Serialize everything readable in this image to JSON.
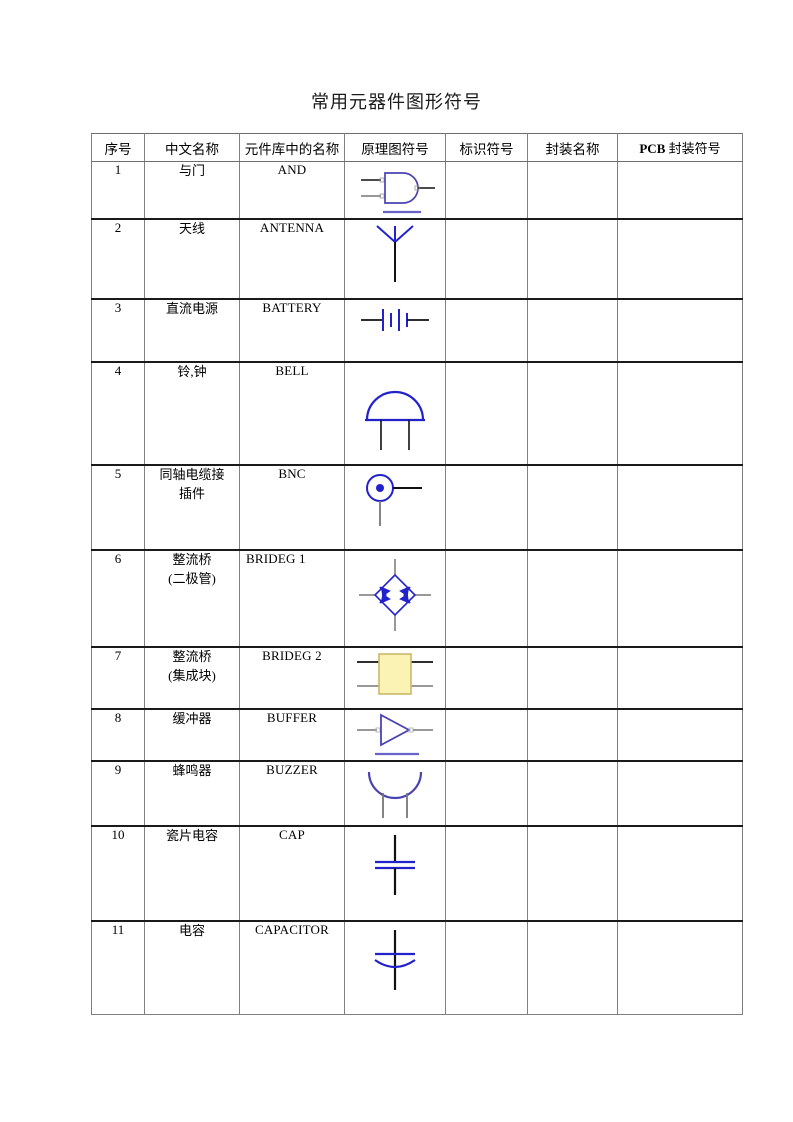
{
  "document": {
    "title": "常用元器件图形符号"
  },
  "table": {
    "headers": [
      "序号",
      "中文名称",
      "元件库中的名称",
      "原理图符号",
      "标识符号",
      "封装名称",
      "PCB 封装符号"
    ],
    "header_pcb_bold_prefix": "PCB",
    "header_pcb_rest": " 封装符号",
    "rows": [
      {
        "index": "1",
        "chinese_name": "与门",
        "library_name": "AND",
        "symbol": "and-gate",
        "designator": "",
        "package_name": "",
        "pcb_symbol": ""
      },
      {
        "index": "2",
        "chinese_name": "天线",
        "library_name": "ANTENNA",
        "symbol": "antenna",
        "designator": "",
        "package_name": "",
        "pcb_symbol": ""
      },
      {
        "index": "3",
        "chinese_name": "直流电源",
        "library_name": "BATTERY",
        "symbol": "battery",
        "designator": "",
        "package_name": "",
        "pcb_symbol": ""
      },
      {
        "index": "4",
        "chinese_name": "铃,钟",
        "library_name": "BELL",
        "symbol": "bell",
        "designator": "",
        "package_name": "",
        "pcb_symbol": ""
      },
      {
        "index": "5",
        "chinese_name": "同轴电缆接插件",
        "library_name": "BNC",
        "symbol": "bnc-connector",
        "designator": "",
        "package_name": "",
        "pcb_symbol": ""
      },
      {
        "index": "6",
        "chinese_name_line1": "整流桥",
        "chinese_name_line2": "(二极管)",
        "library_name": "BRIDEG 1",
        "symbol": "bridge-rectifier-diodes",
        "designator": "",
        "package_name": "",
        "pcb_symbol": ""
      },
      {
        "index": "7",
        "chinese_name_line1": "整流桥",
        "chinese_name_line2": "(集成块)",
        "library_name": "BRIDEG 2",
        "symbol": "bridge-rectifier-ic",
        "designator": "",
        "package_name": "",
        "pcb_symbol": ""
      },
      {
        "index": "8",
        "chinese_name": "缓冲器",
        "library_name": "BUFFER",
        "symbol": "buffer",
        "designator": "",
        "package_name": "",
        "pcb_symbol": ""
      },
      {
        "index": "9",
        "chinese_name": "蜂鸣器",
        "library_name": "BUZZER",
        "symbol": "buzzer",
        "designator": "",
        "package_name": "",
        "pcb_symbol": ""
      },
      {
        "index": "10",
        "chinese_name": "瓷片电容",
        "library_name": "CAP",
        "symbol": "capacitor-nonpolar",
        "designator": "",
        "package_name": "",
        "pcb_symbol": ""
      },
      {
        "index": "11",
        "chinese_name": "电容",
        "library_name": "CAPACITOR",
        "symbol": "capacitor-polar",
        "designator": "",
        "package_name": "",
        "pcb_symbol": ""
      }
    ]
  },
  "colors": {
    "symbol_blue": "#2222cc",
    "symbol_violet": "#4a43b4",
    "lead_black": "#111111",
    "lead_gray": "#777777",
    "ic_fill": "#faf3b4",
    "ic_border": "#c9b96a",
    "border_gray": "#808080",
    "border_black": "#000000"
  },
  "row_5_name_lines": {
    "line1": "同轴电缆接",
    "line2": "插件"
  }
}
